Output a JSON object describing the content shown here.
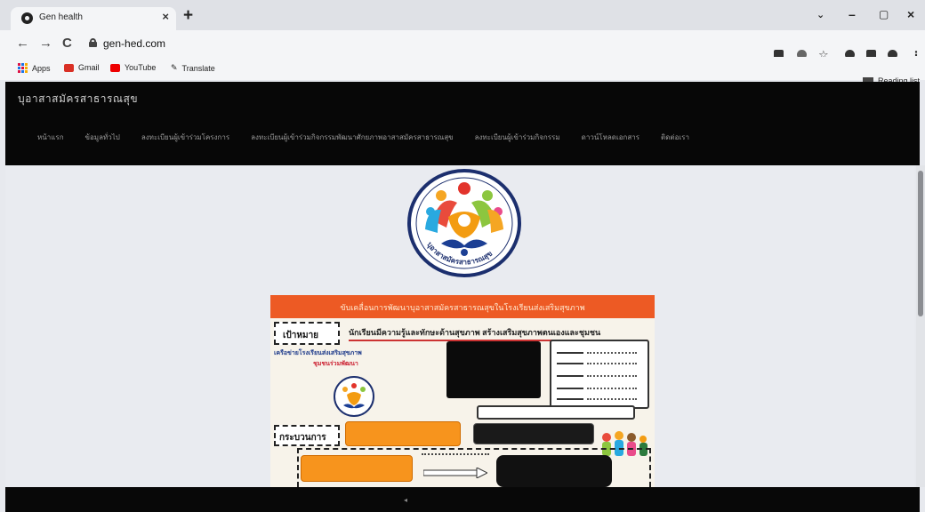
{
  "browser": {
    "tab_title": "Gen health",
    "tab_close": "×",
    "new_tab": "+",
    "url": "gen-hed.com",
    "nav_back": "←",
    "nav_forward": "→",
    "nav_reload": "C",
    "win_min": "–",
    "win_max": "▢",
    "win_close": "×",
    "star": "☆",
    "menu": "⋮",
    "bookmarks": [
      "Apps",
      "Gmail",
      "YouTube",
      "Translate"
    ],
    "reading_list": "Reading list"
  },
  "site": {
    "title": "บุอาสาสมัครสาธารณสุข",
    "nav": [
      "หน้าแรก",
      "ข้อมูลทั่วไป",
      "ลงทะเบียนผู้เข้าร่วมโครงการ",
      "ลงทะเบียนผู้เข้าร่วมกิจกรรมพัฒนาศักยภาพอาสาสมัครสาธารณสุข",
      "ลงทะเบียนผู้เข้าร่วมกิจกรรม",
      "ดาวน์โหลดเอกสาร",
      "ติดต่อเรา"
    ],
    "logo_text": "บุอาสาสมัครสาธารณสุข"
  },
  "poster": {
    "banner": "ขับเคลื่อนการพัฒนาบุอาสาสมัครสาธารณสุขในโรงเรียนส่งเสริมสุขภาพ",
    "goal_label": "เป้าหมาย",
    "goal_text": "นักเรียนมีความรู้และทักษะด้านสุขภาพ สร้างเสริมสุขภาพตนเองและชุมชน",
    "left_line1": "เครือข่ายโรงเรียนส่งเสริมสุขภาพ",
    "left_line2": "ชุมชนร่วมพัฒนา",
    "process_label": "กระบวนการ"
  },
  "colors": {
    "header_bg": "#070707",
    "banner": "#ed5a24",
    "orange_box": "#f7941d",
    "page_bg": "#e9ebf0"
  },
  "icons": [
    "site-favicon-icon",
    "lock-icon",
    "apps-grid-icon",
    "gmail-icon",
    "youtube-icon",
    "translate-icon",
    "reading-list-icon",
    "extension-icon",
    "puzzle-icon",
    "profile-icon"
  ]
}
